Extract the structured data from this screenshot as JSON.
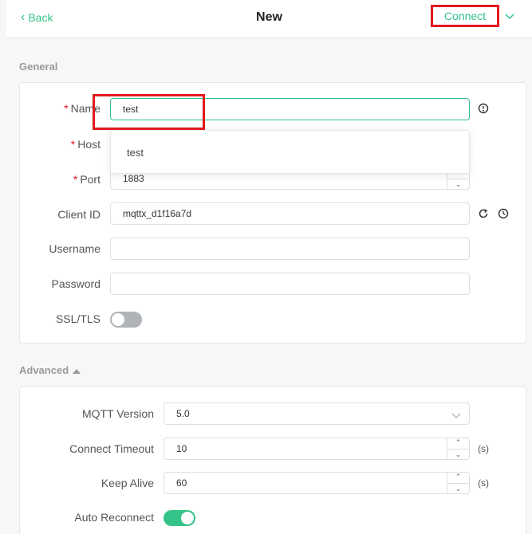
{
  "header": {
    "back_label": "Back",
    "title": "New",
    "connect_label": "Connect"
  },
  "general": {
    "section_label": "General",
    "name": {
      "label": "Name",
      "value": "test"
    },
    "host": {
      "label": "Host",
      "value": ""
    },
    "port": {
      "label": "Port",
      "value": "1883"
    },
    "client_id": {
      "label": "Client ID",
      "value": "mqttx_d1f16a7d"
    },
    "username": {
      "label": "Username",
      "value": ""
    },
    "password": {
      "label": "Password",
      "value": ""
    },
    "ssl": {
      "label": "SSL/TLS",
      "enabled": false
    }
  },
  "name_suggestion": "test",
  "advanced": {
    "section_label": "Advanced",
    "mqtt_version": {
      "label": "MQTT Version",
      "value": "5.0"
    },
    "connect_timeout": {
      "label": "Connect Timeout",
      "value": "10",
      "unit": "(s)"
    },
    "keep_alive": {
      "label": "Keep Alive",
      "value": "60",
      "unit": "(s)"
    },
    "auto_reconnect": {
      "label": "Auto Reconnect",
      "enabled": true
    }
  },
  "colors": {
    "accent": "#34c388",
    "highlight": "#e0191e"
  }
}
